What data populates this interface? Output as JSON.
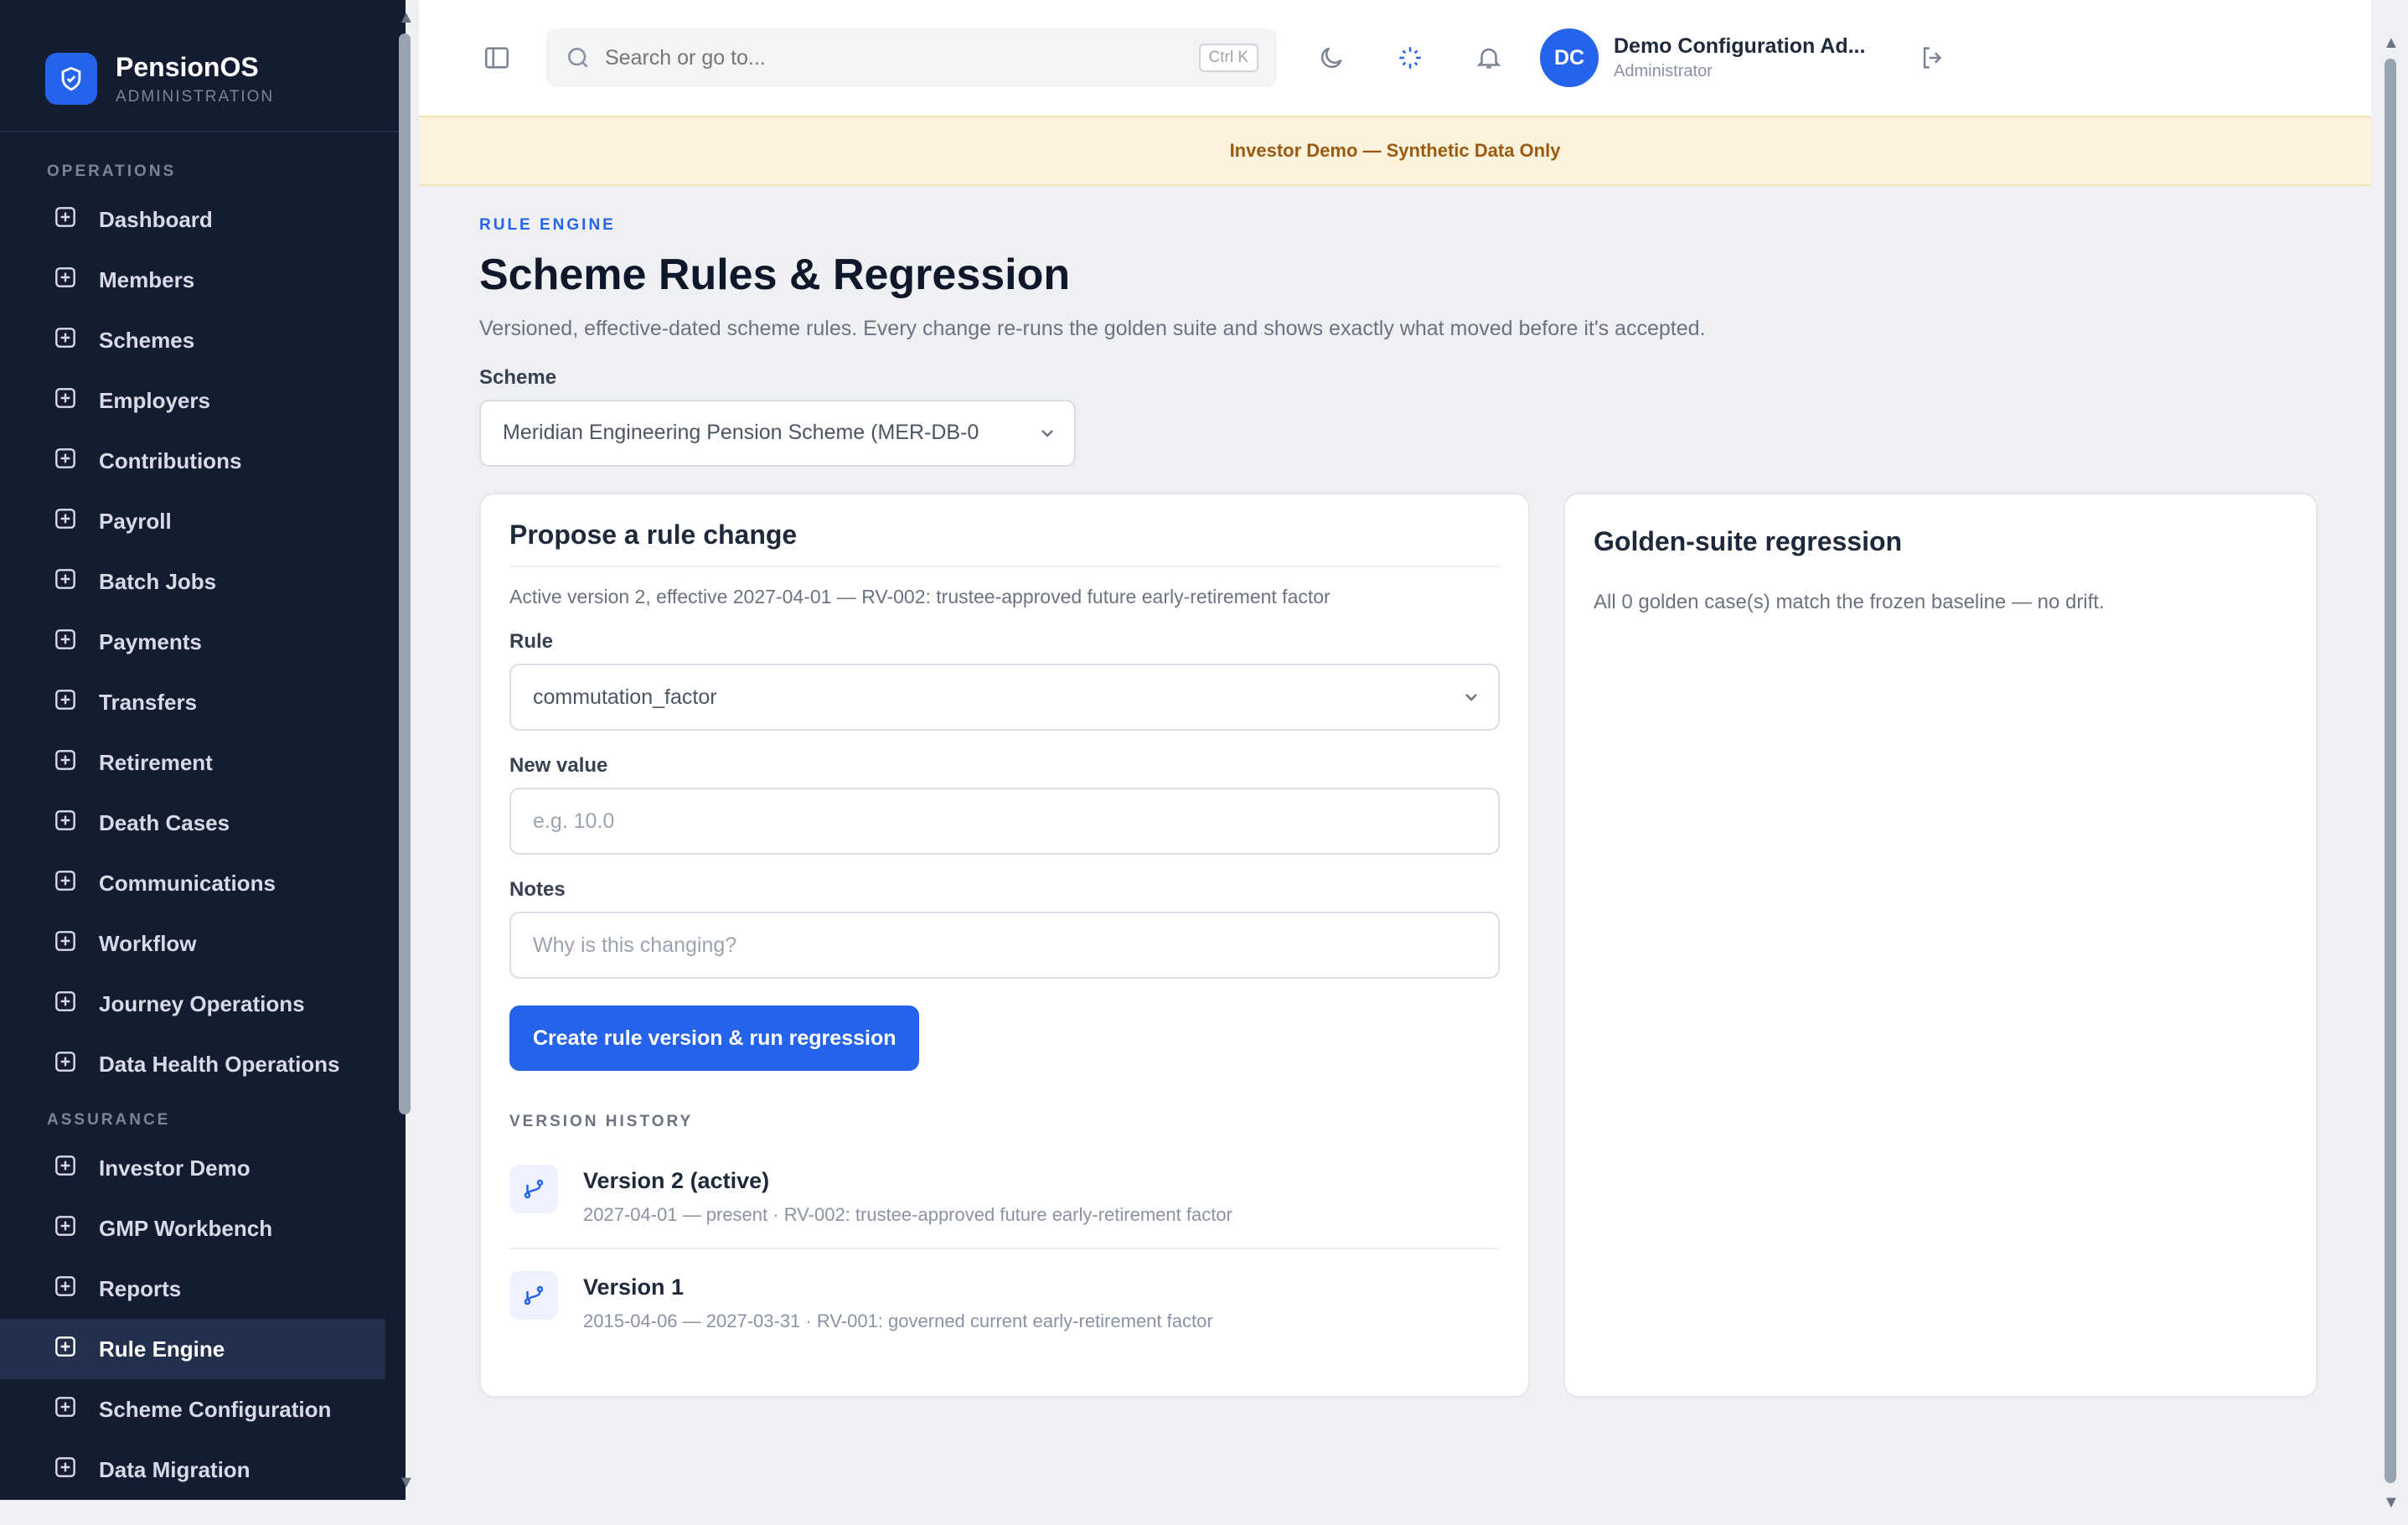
{
  "brand": {
    "name": "PensionOS",
    "subtitle": "ADMINISTRATION"
  },
  "sidebar": {
    "sections": [
      {
        "label": "OPERATIONS",
        "items": [
          {
            "label": "Dashboard",
            "icon": "dashboard-icon"
          },
          {
            "label": "Members",
            "icon": "users-icon"
          },
          {
            "label": "Schemes",
            "icon": "database-icon"
          },
          {
            "label": "Employers",
            "icon": "building-icon"
          },
          {
            "label": "Contributions",
            "icon": "coins-icon"
          },
          {
            "label": "Payroll",
            "icon": "receipt-icon"
          },
          {
            "label": "Batch Jobs",
            "icon": "calendar-icon"
          },
          {
            "label": "Payments",
            "icon": "wallet-icon"
          },
          {
            "label": "Transfers",
            "icon": "transfer-icon"
          },
          {
            "label": "Retirement",
            "icon": "upload-icon"
          },
          {
            "label": "Death Cases",
            "icon": "shield-heart-icon"
          },
          {
            "label": "Communications",
            "icon": "mail-icon"
          },
          {
            "label": "Workflow",
            "icon": "workflow-icon"
          },
          {
            "label": "Journey Operations",
            "icon": "activity-icon"
          },
          {
            "label": "Data Health Operations",
            "icon": "heart-pulse-icon"
          }
        ]
      },
      {
        "label": "ASSURANCE",
        "items": [
          {
            "label": "Investor Demo",
            "icon": "target-icon"
          },
          {
            "label": "GMP Workbench",
            "icon": "flask-icon"
          },
          {
            "label": "Reports",
            "icon": "bar-chart-icon"
          },
          {
            "label": "Rule Engine",
            "icon": "git-branch-icon",
            "active": true
          },
          {
            "label": "Scheme Configuration",
            "icon": "sliders-icon"
          },
          {
            "label": "Data Migration",
            "icon": "database-migrate-icon"
          }
        ]
      }
    ]
  },
  "topbar": {
    "search_placeholder": "Search or go to...",
    "search_shortcut": "Ctrl K",
    "user_initials": "DC",
    "user_name": "Demo Configuration Ad...",
    "user_role": "Administrator"
  },
  "banner": {
    "text": "Investor Demo — Synthetic Data Only"
  },
  "page": {
    "eyebrow": "RULE ENGINE",
    "title": "Scheme Rules & Regression",
    "description": "Versioned, effective-dated scheme rules. Every change re-runs the golden suite and shows exactly what moved before it's accepted.",
    "scheme_label": "Scheme",
    "scheme_value": "Meridian Engineering Pension Scheme (MER-DB-0"
  },
  "propose": {
    "title": "Propose a rule change",
    "active_meta": "Active version 2, effective 2027-04-01 — RV-002: trustee-approved future early-retirement factor",
    "rule_label": "Rule",
    "rule_value": "commutation_factor",
    "new_value_label": "New value",
    "new_value_placeholder": "e.g. 10.0",
    "notes_label": "Notes",
    "notes_placeholder": "Why is this changing?",
    "submit_label": "Create rule version & run regression",
    "history_label": "VERSION HISTORY",
    "history": [
      {
        "title": "Version 2 (active)",
        "sub": "2027-04-01 — present · RV-002: trustee-approved future early-retirement factor"
      },
      {
        "title": "Version 1",
        "sub": "2015-04-06 — 2027-03-31 · RV-001: governed current early-retirement factor"
      }
    ]
  },
  "golden": {
    "title": "Golden-suite regression",
    "text": "All 0 golden case(s) match the frozen baseline — no drift."
  },
  "colors": {
    "accent": "#2563eb",
    "sidebar_bg": "#131c31",
    "banner_bg": "#fdf3dd"
  }
}
